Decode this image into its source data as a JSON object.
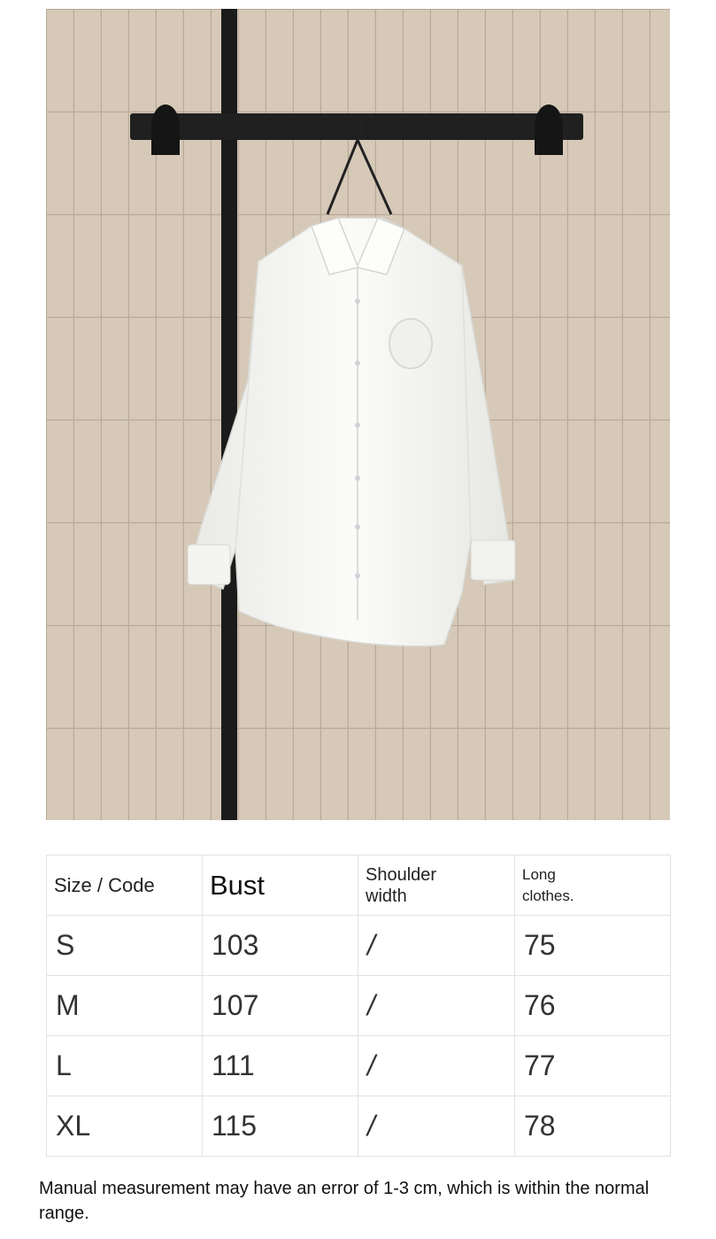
{
  "photo": {
    "alt": "White long-sleeve button-down shirt with embroidered crest on a hanger against a beige tile wall",
    "colors": {
      "tile": "#cdbfae",
      "grout": "#b6a897",
      "rail": "#1f1f1f",
      "shirt": "#f6f6f4"
    }
  },
  "size_table": {
    "headers": {
      "size": "Size / Code",
      "bust": "Bust",
      "shoulder_line1": "Shoulder",
      "shoulder_line2": "width",
      "length_line1": "Long",
      "length_line2": "clothes."
    },
    "rows": [
      {
        "size": "S",
        "bust": "103",
        "shoulder": "/",
        "length": "75"
      },
      {
        "size": "M",
        "bust": "107",
        "shoulder": "/",
        "length": "76"
      },
      {
        "size": "L",
        "bust": "111",
        "shoulder": "/",
        "length": "77"
      },
      {
        "size": "XL",
        "bust": "115",
        "shoulder": "/",
        "length": "78"
      }
    ]
  },
  "note": "Manual measurement may have an error of 1-3 cm, which is within the normal range."
}
